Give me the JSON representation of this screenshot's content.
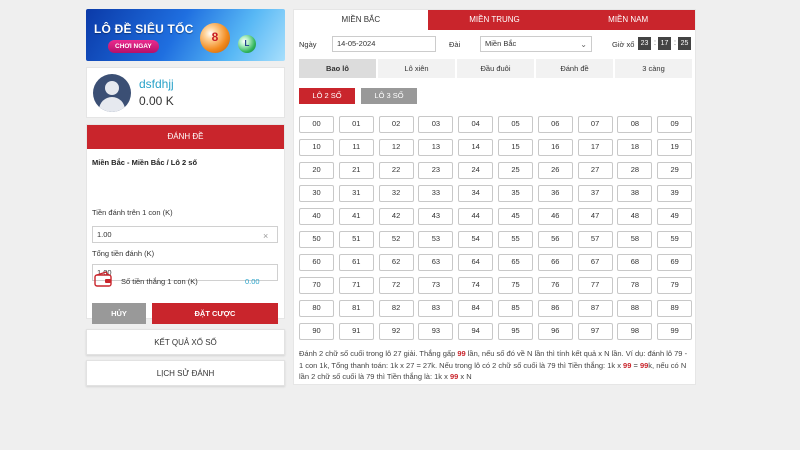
{
  "banner": {
    "title": "LÔ ĐỀ SIÊU TỐC",
    "cta_label": "CHƠI NGAY",
    "ball1": "8",
    "ball2": "L"
  },
  "profile": {
    "username": "dsfdhjj",
    "balance": "0.00 K"
  },
  "bet_panel": {
    "header": "ĐÁNH ĐỀ",
    "breadcrumb": "Miền Bắc - Miền Bắc / Lô 2 số",
    "per_number_label": "Tiền đánh trên 1 con (K)",
    "per_number_value": "1.00",
    "clear_icon": "×",
    "total_label": "Tổng tiền đánh (K)",
    "total_value": "1.00",
    "win_label": "Số tiền thắng 1 con (K)",
    "win_value": "0.00",
    "cancel_label": "HỦY",
    "place_bet_label": "ĐẶT CƯỢC"
  },
  "links": {
    "results": "KẾT QUẢ XỔ SỐ",
    "history": "LỊCH SỬ ĐÁNH"
  },
  "regions": [
    "MIỀN BẮC",
    "MIỀN TRUNG",
    "MIỀN NAM"
  ],
  "filters": {
    "date_label": "Ngày",
    "date_value": "14-05-2024",
    "region_label": "Đài",
    "region_value": "Miền Bắc",
    "timer_label": "Giờ xổ",
    "timer_hours": "23",
    "timer_minutes": "17",
    "timer_seconds": "25"
  },
  "bet_types": [
    "Bao lô",
    "Lô xiên",
    "Đầu đuôi",
    "Đánh đề",
    "3 càng"
  ],
  "subtypes": [
    "LÔ 2 SỐ",
    "LÔ 3 SỐ"
  ],
  "numbers": [
    "00",
    "01",
    "02",
    "03",
    "04",
    "05",
    "06",
    "07",
    "08",
    "09",
    "10",
    "11",
    "12",
    "13",
    "14",
    "15",
    "16",
    "17",
    "18",
    "19",
    "20",
    "21",
    "22",
    "23",
    "24",
    "25",
    "26",
    "27",
    "28",
    "29",
    "30",
    "31",
    "32",
    "33",
    "34",
    "35",
    "36",
    "37",
    "38",
    "39",
    "40",
    "41",
    "42",
    "43",
    "44",
    "45",
    "46",
    "47",
    "48",
    "49",
    "50",
    "51",
    "52",
    "53",
    "54",
    "55",
    "56",
    "57",
    "58",
    "59",
    "60",
    "61",
    "62",
    "63",
    "64",
    "65",
    "66",
    "67",
    "68",
    "69",
    "70",
    "71",
    "72",
    "73",
    "74",
    "75",
    "76",
    "77",
    "78",
    "79",
    "80",
    "81",
    "82",
    "83",
    "84",
    "85",
    "86",
    "87",
    "88",
    "89",
    "90",
    "91",
    "92",
    "93",
    "94",
    "95",
    "96",
    "97",
    "98",
    "99"
  ],
  "description": {
    "p1": "Đánh 2 chữ số cuối trong lô 27 giải. Thắng gấp ",
    "h1": "99",
    "p2": " lần, nếu số đó về N lần thì tính kết quả x N lần. Ví dụ: đánh lô 79 - 1 con 1k, Tổng thanh toán: 1k x 27 = 27k. Nếu trong lô có 2 chữ số cuối là 79 thì Tiền thắng: 1k x ",
    "h2": "99",
    "p3": " = ",
    "h3": "99",
    "p4": "k, nếu có N lần 2 chữ số cuối là 79 thì Tiền thắng là: 1k x ",
    "h4": "99",
    "p5": " x N"
  },
  "colors": {
    "accent": "#c9252c",
    "link": "#2aa3c9",
    "inactive": "#999999"
  }
}
